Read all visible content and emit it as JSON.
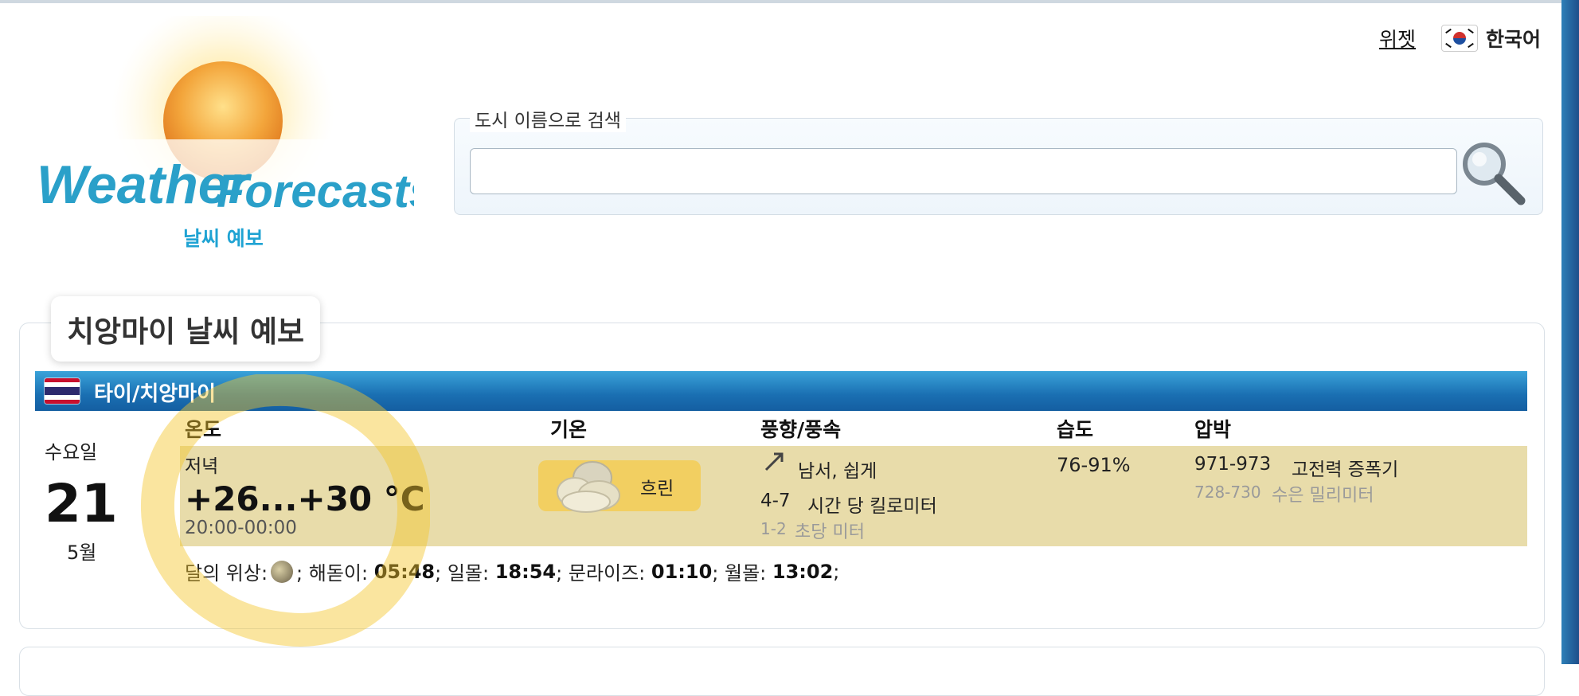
{
  "header": {
    "logo_word1": "Weather",
    "logo_word2": "Forecasts",
    "tagline": "날씨 예보",
    "widget_link": "위젯",
    "language": "한국어"
  },
  "search": {
    "legend": "도시 이름으로 검색",
    "value": "",
    "placeholder": ""
  },
  "forecast": {
    "title": "치앙마이 날씨 예보",
    "location": "타이/치앙마이",
    "columns": {
      "temperature": "온도",
      "sky": "기온",
      "wind": "풍향/풍속",
      "humidity": "습도",
      "pressure": "압박"
    },
    "date": {
      "weekday": "수요일",
      "day": "21",
      "month": "5월"
    },
    "row": {
      "period": "저녁",
      "temp": "+26...+30 °C",
      "time": "20:00-00:00",
      "sky_text": "흐린",
      "sky_icon": "cloud-icon",
      "wind_direction": "남서, 쉽게",
      "wind_kmh_value": "4-7",
      "wind_kmh_unit": "시간 당 킬로미터",
      "wind_ms_value": "1-2",
      "wind_ms_unit": "초당 미터",
      "humidity": "76-91%",
      "pressure_hpa_value": "971-973",
      "pressure_hpa_unit": "고전력 증폭기",
      "pressure_mm_value": "728-730",
      "pressure_mm_unit": "수은 밀리미터"
    },
    "astro": {
      "moon_label": "달의 위상:",
      "sunrise_label": "; 해돋이: ",
      "sunrise": "05:48",
      "sunset_label": "; 일몰: ",
      "sunset": "18:54",
      "moonrise_label": "; 문라이즈: ",
      "moonrise": "01:10",
      "moonset_label": "; 월몰: ",
      "moonset": "13:02",
      "end": ";"
    }
  },
  "colors": {
    "accent_blue": "#1fa3d3",
    "location_bar": "#1a6fb2",
    "row_highlight": "#e8dcaa",
    "sky_badge": "#f2cf61"
  }
}
